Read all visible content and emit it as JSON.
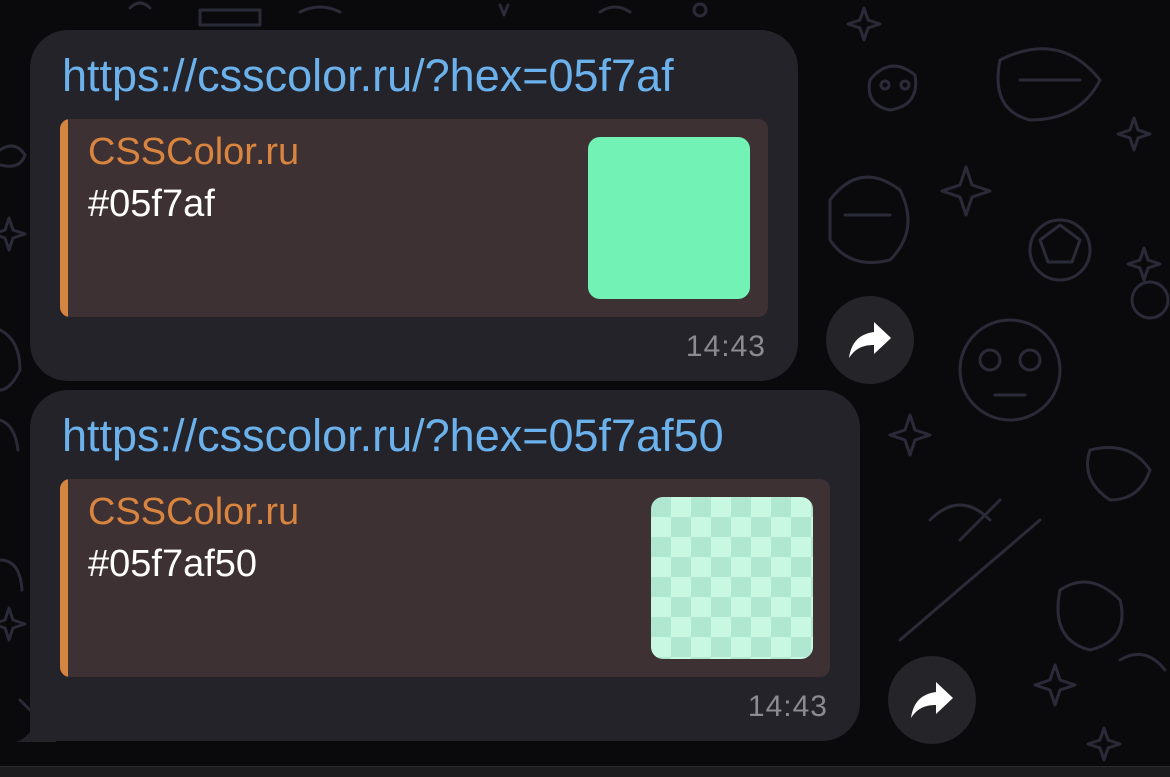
{
  "messages": [
    {
      "link": "https://csscolor.ru/?hex=05f7af",
      "preview": {
        "site_name": "CSSColor.ru",
        "title": "#05f7af",
        "swatch_color": "#05f7af",
        "swatch_style": "solid"
      },
      "time": "14:43",
      "share_icon": "share-arrow-icon"
    },
    {
      "link": "https://csscolor.ru/?hex=05f7af50",
      "preview": {
        "site_name": "CSSColor.ru",
        "title": "#05f7af50",
        "swatch_color": "#05f7af50",
        "swatch_style": "checkerboard-transparent"
      },
      "time": "14:43",
      "share_icon": "share-arrow-icon"
    }
  ],
  "colors": {
    "link": "#6bb1ec",
    "site_name": "#d9853f",
    "bubble": "#242329",
    "preview_bg": "#3e3133"
  }
}
